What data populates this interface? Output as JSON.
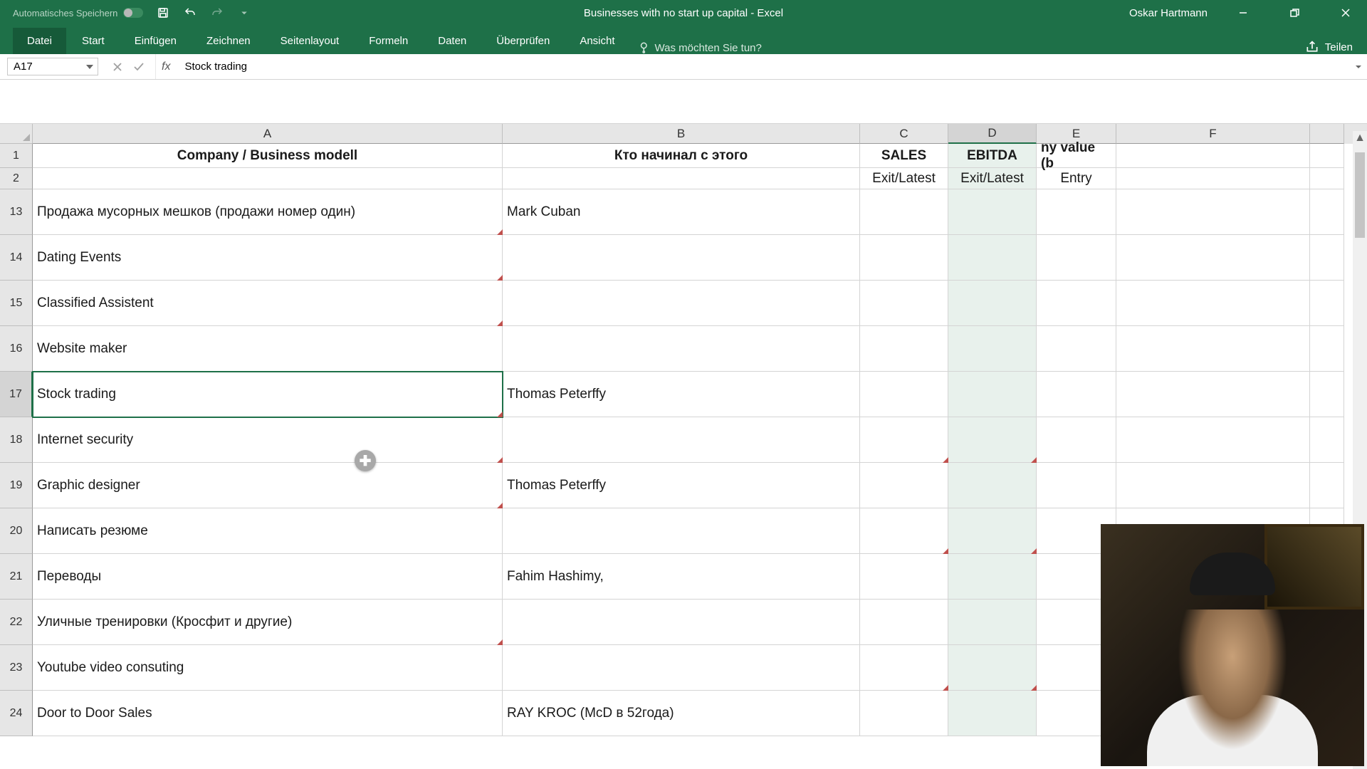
{
  "titlebar": {
    "auto_save": "Automatisches Speichern",
    "title": "Businesses with no start up capital  -  Excel",
    "user": "Oskar Hartmann"
  },
  "ribbon": {
    "tabs": [
      "Datei",
      "Start",
      "Einfügen",
      "Zeichnen",
      "Seitenlayout",
      "Formeln",
      "Daten",
      "Überprüfen",
      "Ansicht"
    ],
    "tellme": "Was möchten Sie tun?",
    "share": "Teilen"
  },
  "formula_bar": {
    "name_box": "A17",
    "value": "Stock trading"
  },
  "columns": [
    "A",
    "B",
    "C",
    "D",
    "E",
    "F"
  ],
  "header_rows": {
    "1": {
      "A": "Company  / Business modell",
      "B": "Кто начинал с этого",
      "C": "SALES",
      "D": "EBITDA",
      "E": "ny value (b"
    },
    "2": {
      "C": "Exit/Latest",
      "D": "Exit/Latest",
      "E": "Entry"
    }
  },
  "rows": [
    {
      "n": 13,
      "A": "Продажа мусорных мешков (продажи номер один)",
      "B": "Mark Cuban",
      "marks": {
        "A": "br"
      }
    },
    {
      "n": 14,
      "A": "Dating Events",
      "marks": {
        "A": "br"
      }
    },
    {
      "n": 15,
      "A": "Classified Assistent",
      "marks": {
        "A": "br"
      }
    },
    {
      "n": 16,
      "A": "Website maker"
    },
    {
      "n": 17,
      "A": "Stock trading",
      "B": "Thomas Peterffy",
      "active": true,
      "marks": {
        "A": "br"
      }
    },
    {
      "n": 18,
      "A": "Internet security",
      "marks": {
        "A": "br",
        "C": "br",
        "D": "br"
      }
    },
    {
      "n": 19,
      "A": "Graphic designer",
      "B": "Thomas Peterffy",
      "marks": {
        "A": "br"
      }
    },
    {
      "n": 20,
      "A": "Написать резюме",
      "marks": {
        "C": "br",
        "D": "br"
      }
    },
    {
      "n": 21,
      "A": "Переводы",
      "B": "Fahim Hashimy,"
    },
    {
      "n": 22,
      "A": "Уличные тренировки (Кросфит и другие)",
      "marks": {
        "A": "br"
      }
    },
    {
      "n": 23,
      "A": "Youtube video consuting",
      "marks": {
        "C": "br",
        "D": "br"
      }
    },
    {
      "n": 24,
      "A": "Door to Door Sales",
      "B": "RAY KROC (McD в 52года)"
    }
  ],
  "selected_col": "D",
  "active_cell": "A17",
  "plus_badge_row": 18
}
